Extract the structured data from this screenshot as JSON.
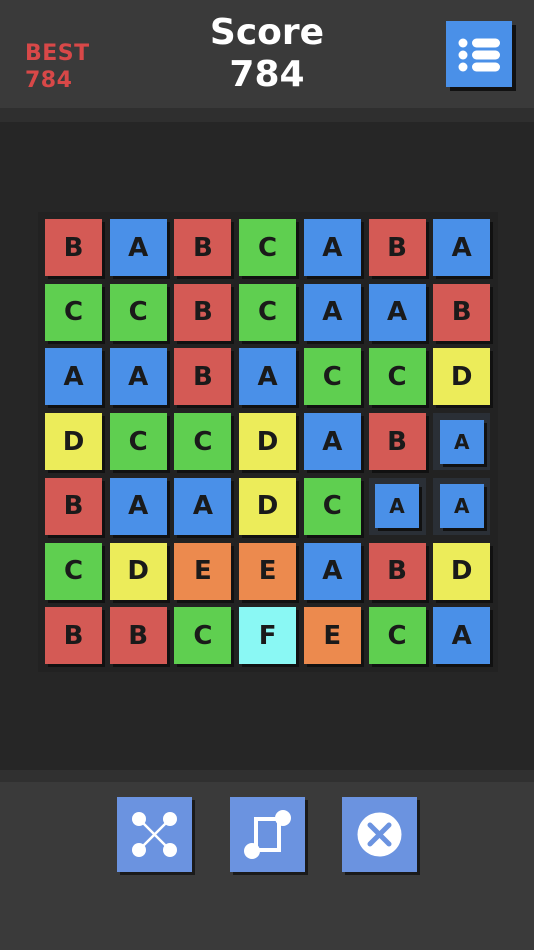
{
  "header": {
    "best_label": "BEST",
    "best_value": "784",
    "score_label": "Score",
    "score_value": "784"
  },
  "menu": {
    "icon": "menu-list-icon"
  },
  "colors": {
    "A": "#4a90e8",
    "B": "#d45a55",
    "C": "#5fcf50",
    "D": "#ecec5a",
    "E": "#ec8a4e",
    "F": "#8af8f4",
    "best": "#d84848",
    "button": "#6b93e0"
  },
  "board": {
    "rows": [
      [
        "B",
        "A",
        "B",
        "C",
        "A",
        "B",
        "A"
      ],
      [
        "C",
        "C",
        "B",
        "C",
        "A",
        "A",
        "B"
      ],
      [
        "A",
        "A",
        "B",
        "A",
        "C",
        "C",
        "D"
      ],
      [
        "D",
        "C",
        "C",
        "D",
        "A",
        "B",
        "A*"
      ],
      [
        "B",
        "A",
        "A",
        "D",
        "C",
        "A*",
        "A*"
      ],
      [
        "C",
        "D",
        "E",
        "E",
        "A",
        "B",
        "D"
      ],
      [
        "B",
        "B",
        "C",
        "F",
        "E",
        "C",
        "A"
      ]
    ],
    "note_selected_marker": "*"
  },
  "tools": [
    {
      "icon": "shuffle-icon"
    },
    {
      "icon": "swap-icon"
    },
    {
      "icon": "remove-icon"
    }
  ]
}
